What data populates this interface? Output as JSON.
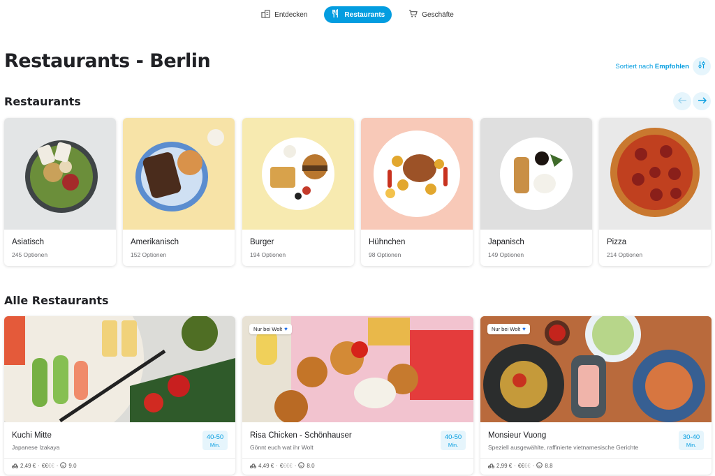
{
  "nav": {
    "tabs": [
      {
        "label": "Entdecken",
        "icon": "building-icon"
      },
      {
        "label": "Restaurants",
        "icon": "fork-knife-icon",
        "active": true
      },
      {
        "label": "Geschäfte",
        "icon": "cart-icon"
      }
    ]
  },
  "page": {
    "title": "Restaurants - Berlin",
    "sort_prefix": "Sortiert nach",
    "sort_value": "Empfohlen"
  },
  "categories_section": {
    "title": "Restaurants",
    "items": [
      {
        "name": "Asiatisch",
        "count": "245 Optionen"
      },
      {
        "name": "Amerikanisch",
        "count": "152 Optionen"
      },
      {
        "name": "Burger",
        "count": "194 Optionen"
      },
      {
        "name": "Hühnchen",
        "count": "98 Optionen"
      },
      {
        "name": "Japanisch",
        "count": "149 Optionen"
      },
      {
        "name": "Pizza",
        "count": "214 Optionen"
      }
    ]
  },
  "restaurants_section": {
    "title": "Alle Restaurants",
    "items": [
      {
        "name": "Kuchi Mitte",
        "desc": "Japanese Izakaya",
        "eta": "40-50",
        "eta_unit": "Min.",
        "delivery": "2,49 €",
        "price_on": "€€",
        "price_off": "€€",
        "rating": "9.0",
        "badge": ""
      },
      {
        "name": "Risa Chicken - Schönhauser",
        "desc": "Gönnt euch wat ihr Wolt",
        "eta": "40-50",
        "eta_unit": "Min.",
        "delivery": "4,49 €",
        "price_on": "€",
        "price_off": "€€€",
        "rating": "8.0",
        "badge": "Nur bei Wolt"
      },
      {
        "name": "Monsieur Vuong",
        "desc": "Speziell ausgewählte, raffinierte vietnamesische Gerichte",
        "eta": "30-40",
        "eta_unit": "Min.",
        "delivery": "2,99 €",
        "price_on": "€€",
        "price_off": "€€",
        "rating": "8.8",
        "badge": "Nur bei Wolt"
      }
    ]
  },
  "meta_separator": "·",
  "colors": {
    "accent": "#039de0",
    "accent_light": "#e6f5fc",
    "text": "#202125",
    "muted": "#6b6c70"
  }
}
